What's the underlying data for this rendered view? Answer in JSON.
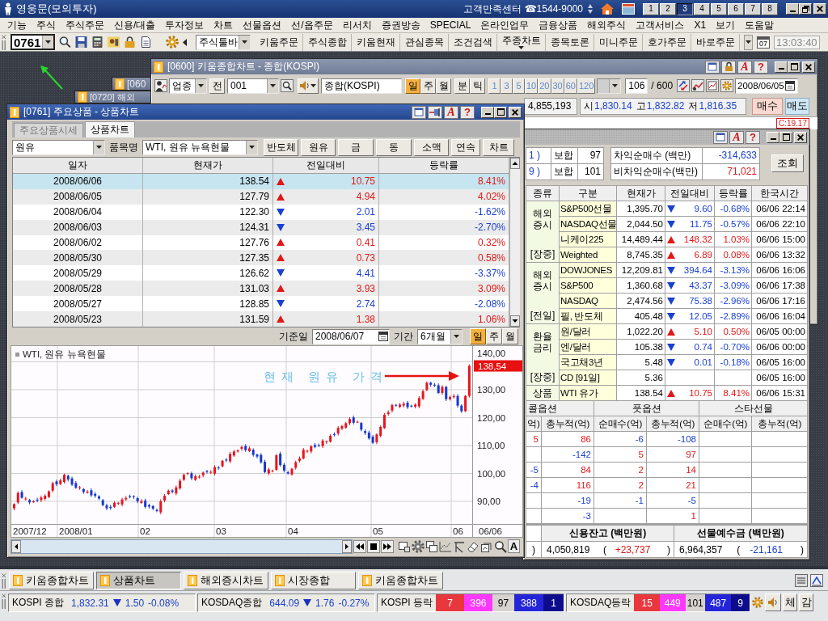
{
  "app": {
    "title": "영웅문(모의투자)",
    "support_label": "고객만족센터",
    "phone": "☎1544-9000",
    "screen_buttons": [
      {
        "label": "1",
        "selected": false
      },
      {
        "label": "2",
        "selected": false
      },
      {
        "label": "3",
        "selected": true
      },
      {
        "label": "4",
        "selected": false
      },
      {
        "label": "5",
        "selected": false
      },
      {
        "label": "6",
        "selected": false
      },
      {
        "label": "7",
        "selected": false
      },
      {
        "label": "8",
        "selected": false
      }
    ]
  },
  "menu": [
    "기능",
    "주식",
    "주식주문",
    "신용/대출",
    "투자정보",
    "차트",
    "선물옵션",
    "선/옵주문",
    "리서치",
    "증권방송",
    "SPECIAL",
    "온라인업무",
    "금융상품",
    "해외주식",
    "고객서비스",
    "X1",
    "보기",
    "도움말"
  ],
  "toolbar": {
    "screen_code": "0761",
    "toolbar_select": "주식툴바",
    "buttons": [
      {
        "label": "키움주문",
        "has_menu": false
      },
      {
        "label": "주식종합",
        "has_menu": false
      },
      {
        "label": "키움현재",
        "has_menu": false
      },
      {
        "label": "관심종목",
        "has_menu": false
      },
      {
        "label": "조건검색",
        "has_menu": false
      },
      {
        "label": "주종차트",
        "has_menu": true
      },
      {
        "label": "종목토론",
        "has_menu": false
      },
      {
        "label": "미니주문",
        "has_menu": false
      },
      {
        "label": "호가주문",
        "has_menu": false
      },
      {
        "label": "바로주문",
        "has_menu": false
      }
    ],
    "calendar_day": "07",
    "clock": "13:03:40"
  },
  "back_windows": [
    {
      "title": "[060"
    },
    {
      "title": "[0720] 해외"
    }
  ],
  "chart_window": {
    "title": "[0600] 키움종합차트 - 종합(KOSPI)",
    "font_label": "A",
    "help_label": "?",
    "market": "업종",
    "prev_label": "전",
    "code": "001",
    "name": "종합(KOSPI)",
    "periods": [
      {
        "label": "일",
        "selected": true
      },
      {
        "label": "주",
        "selected": false
      },
      {
        "label": "월",
        "selected": false
      }
    ],
    "intervals": [
      "분",
      "틱"
    ],
    "steps": [
      "1",
      "3",
      "5",
      "10",
      "20",
      "30",
      "60",
      "120"
    ],
    "count": "106",
    "max_count": "/ 600",
    "date": "2008/06/05",
    "volume": "4,855,193",
    "prices": [
      {
        "label": "시",
        "value": "1,830.14"
      },
      {
        "label": "고",
        "value": "1,832.82"
      },
      {
        "label": "저",
        "value": "1,816.35"
      }
    ],
    "buy_label": "매수",
    "sell_label": "매도",
    "indicator": "C:19.17"
  },
  "product_window": {
    "title": "[0761] 주요상품 - 상품차트",
    "font_label": "A",
    "help_label": "?",
    "tabs": [
      {
        "label": "주요상품시세",
        "selected": false
      },
      {
        "label": "상품차트",
        "selected": true
      }
    ],
    "category": "원유",
    "item_label": "품목명",
    "item": "WTI, 원유 뉴욕현물",
    "quick_buttons": [
      "반도체",
      "원유",
      "금",
      "동",
      "소맥",
      "연속",
      "차트"
    ],
    "table": {
      "columns": [
        "일자",
        "현재가",
        "전일대비",
        "등락률"
      ],
      "rows": [
        {
          "date": "2008/06/06",
          "price": "138.54",
          "rising": true,
          "change": "10.75",
          "rate": "8.41%",
          "selected": true
        },
        {
          "date": "2008/06/05",
          "price": "127.79",
          "rising": true,
          "change": "4.94",
          "rate": "4.02%",
          "selected": false
        },
        {
          "date": "2008/06/04",
          "price": "122.30",
          "rising": false,
          "change": "2.01",
          "rate": "-1.62%",
          "selected": false
        },
        {
          "date": "2008/06/03",
          "price": "124.31",
          "rising": false,
          "change": "3.45",
          "rate": "-2.70%",
          "selected": false
        },
        {
          "date": "2008/06/02",
          "price": "127.76",
          "rising": true,
          "change": "0.41",
          "rate": "0.32%",
          "selected": false
        },
        {
          "date": "2008/05/30",
          "price": "127.35",
          "rising": true,
          "change": "0.73",
          "rate": "0.58%",
          "selected": false
        },
        {
          "date": "2008/05/29",
          "price": "126.62",
          "rising": false,
          "change": "4.41",
          "rate": "-3.37%",
          "selected": false
        },
        {
          "date": "2008/05/28",
          "price": "131.03",
          "rising": true,
          "change": "3.93",
          "rate": "3.09%",
          "selected": false
        },
        {
          "date": "2008/05/27",
          "price": "128.85",
          "rising": false,
          "change": "2.74",
          "rate": "-2.08%",
          "selected": false
        },
        {
          "date": "2008/05/23",
          "price": "131.59",
          "rising": true,
          "change": "1.38",
          "rate": "1.06%",
          "selected": false
        }
      ]
    },
    "base_date_label": "기준일",
    "base_date": "2008/06/07",
    "period_label": "기간",
    "period": "6개월",
    "periods": [
      {
        "label": "일",
        "selected": true
      },
      {
        "label": "주",
        "selected": false
      },
      {
        "label": "월",
        "selected": false
      }
    ],
    "chart": {
      "legend": "WTI, 원유 뉴욕현물",
      "y_labels": [
        "140,00",
        "130,00",
        "120,00",
        "110,00",
        "100,00",
        "90,00"
      ],
      "x_labels": [
        "2007/12",
        "2008/01",
        "02",
        "03",
        "04",
        "05",
        "06"
      ],
      "last_date": "06/06",
      "last_price": "138,54",
      "callout": "현재 원유 가격",
      "font_label": "A"
    }
  },
  "market_window": {
    "font_label": "A",
    "help_label": "?",
    "breadth": [
      {
        "count": "1 )",
        "label": "보합",
        "value": "97"
      },
      {
        "count": "9 )",
        "label": "보합",
        "value": "101"
      }
    ],
    "program": [
      {
        "label": "차익순매수 (백만)",
        "value": "-314,633",
        "rising": false
      },
      {
        "label": "비차익순매수(백만)",
        "value": "71,021",
        "rising": true
      }
    ],
    "query_button": "조회",
    "table": {
      "columns": [
        "종류",
        "구분",
        "현재가",
        "전일대비",
        "등락률",
        "한국시간"
      ],
      "groups": [
        {
          "name": "해외 증시",
          "status": "[장중]",
          "rows": [
            {
              "item": "S&P500선물",
              "price": "1,395.70",
              "rising": false,
              "change": "9.60",
              "rate": "-0.68%",
              "time": "06/06 22:14"
            },
            {
              "item": "NASDAQ선물",
              "price": "2,044.50",
              "rising": false,
              "change": "11.75",
              "rate": "-0.57%",
              "time": "06/06 22:10"
            },
            {
              "item": "니케이225",
              "price": "14,489.44",
              "rising": true,
              "change": "148.32",
              "rate": "1.03%",
              "time": "06/06 15:00"
            },
            {
              "item": "Weighted",
              "price": "8,745.35",
              "rising": true,
              "change": "6.89",
              "rate": "0.08%",
              "time": "06/06 13:32"
            }
          ]
        },
        {
          "name": "해외 증시",
          "status": "[전일]",
          "rows": [
            {
              "item": "DOWJONES",
              "price": "12,209.81",
              "rising": false,
              "change": "394.64",
              "rate": "-3.13%",
              "time": "06/06 16:06"
            },
            {
              "item": "S&P500",
              "price": "1,360.68",
              "rising": false,
              "change": "43.37",
              "rate": "-3.09%",
              "time": "06/06 17:38"
            },
            {
              "item": "NASDAQ",
              "price": "2,474.56",
              "rising": false,
              "change": "75.38",
              "rate": "-2.96%",
              "time": "06/06 17:16"
            },
            {
              "item": "필, 반도체",
              "price": "405.48",
              "rising": false,
              "change": "12.05",
              "rate": "-2.89%",
              "time": "06/06 16:04"
            }
          ]
        },
        {
          "name": "환율 금리",
          "status": "[장중]",
          "rows": [
            {
              "item": "원/달러",
              "price": "1,022.20",
              "rising": true,
              "change": "5.10",
              "rate": "0.50%",
              "time": "06/05 00:00"
            },
            {
              "item": "엔/달러",
              "price": "105.38",
              "rising": false,
              "change": "0.74",
              "rate": "-0.70%",
              "time": "06/06 00:00"
            },
            {
              "item": "국고채3년",
              "price": "5.48",
              "rising": false,
              "change": "0.01",
              "rate": "-0.18%",
              "time": "06/05 16:00"
            },
            {
              "item": "CD [91일]",
              "price": "5.36",
              "time": "06/05 16:00"
            }
          ]
        },
        {
          "name": "상품",
          "rows": [
            {
              "item": "WTI 유가",
              "price": "138.54",
              "rising": true,
              "change": "10.75",
              "rate": "8.41%",
              "time": "06/06 15:31"
            }
          ]
        }
      ]
    },
    "options": {
      "groups": [
        "콜옵션",
        "풋옵션",
        "스타선물"
      ],
      "columns": [
        "억)",
        "총누적(억)",
        "순매수(억)",
        "총누적(억)",
        "순매수(억)",
        "총누적(억)"
      ],
      "rows": [
        [
          {
            "text": "5",
            "rising": true
          },
          {
            "text": "86",
            "rising": true
          },
          {
            "text": "-6",
            "rising": false
          },
          {
            "text": "-108",
            "rising": false
          },
          null,
          null
        ],
        [
          null,
          {
            "text": "-142",
            "rising": false
          },
          {
            "text": "5",
            "rising": true
          },
          {
            "text": "97",
            "rising": true
          },
          null,
          null
        ],
        [
          {
            "text": "-5",
            "rising": false
          },
          {
            "text": "84",
            "rising": true
          },
          {
            "text": "2",
            "rising": true
          },
          {
            "text": "14",
            "rising": true
          },
          null,
          null
        ],
        [
          {
            "text": "-4",
            "rising": false
          },
          {
            "text": "116",
            "rising": true
          },
          {
            "text": "2",
            "rising": true
          },
          {
            "text": "21",
            "rising": true
          },
          null,
          null
        ],
        [
          null,
          {
            "text": "-19",
            "rising": false
          },
          {
            "text": "-1",
            "rising": false
          },
          {
            "text": "-5",
            "rising": false
          },
          null,
          null
        ],
        [
          null,
          {
            "text": "-3",
            "rising": false
          },
          null,
          {
            "text": "1",
            "rising": true
          },
          null,
          null
        ]
      ]
    },
    "credit": {
      "lead": ")",
      "headers": [
        "신용잔고 (백만원)",
        "선물예수금 (백만원)"
      ],
      "values": [
        {
          "amount": "4,050,819",
          "open": "(",
          "change": "+23,737",
          "close": ")",
          "rising": true
        },
        {
          "amount": "6,964,357",
          "open": "(",
          "change": "-21,161",
          "close": ")",
          "rising": false
        }
      ]
    }
  },
  "taskbar": [
    {
      "label": "키움종합차트",
      "selected": false
    },
    {
      "label": "상품차트",
      "selected": true
    },
    {
      "label": "해외증시차트",
      "selected": false
    },
    {
      "label": "시장종합",
      "selected": false
    },
    {
      "label": "키움종합차트",
      "selected": false
    }
  ],
  "status_bar": {
    "indices": [
      {
        "label": "KOSPI 종합",
        "value": "1,832.31",
        "rising": false,
        "change": "1.50",
        "rate": "-0.08%"
      },
      {
        "label": "KOSDAQ종합",
        "value": "644.09",
        "rising": false,
        "change": "1.76",
        "rate": "-0.27%"
      }
    ],
    "breadth": [
      {
        "label": "KOSPI 등락",
        "counts": [
          {
            "text": "7",
            "color": "#e8383d"
          },
          {
            "text": "396",
            "color": "#ff38ff"
          },
          {
            "text": "97",
            "color": "#d6d3ce"
          },
          {
            "text": "388",
            "color": "#2424d8"
          },
          {
            "text": "1",
            "color": "#0c0c8c"
          }
        ]
      },
      {
        "label": "KOSDAQ등락",
        "counts": [
          {
            "text": "15",
            "color": "#e8383d"
          },
          {
            "text": "449",
            "color": "#ff38ff"
          },
          {
            "text": "101",
            "color": "#d6d3ce"
          },
          {
            "text": "487",
            "color": "#2424d8"
          },
          {
            "text": "9",
            "color": "#0c0c8c"
          }
        ]
      }
    ],
    "buttons": [
      "체",
      "감"
    ]
  }
}
